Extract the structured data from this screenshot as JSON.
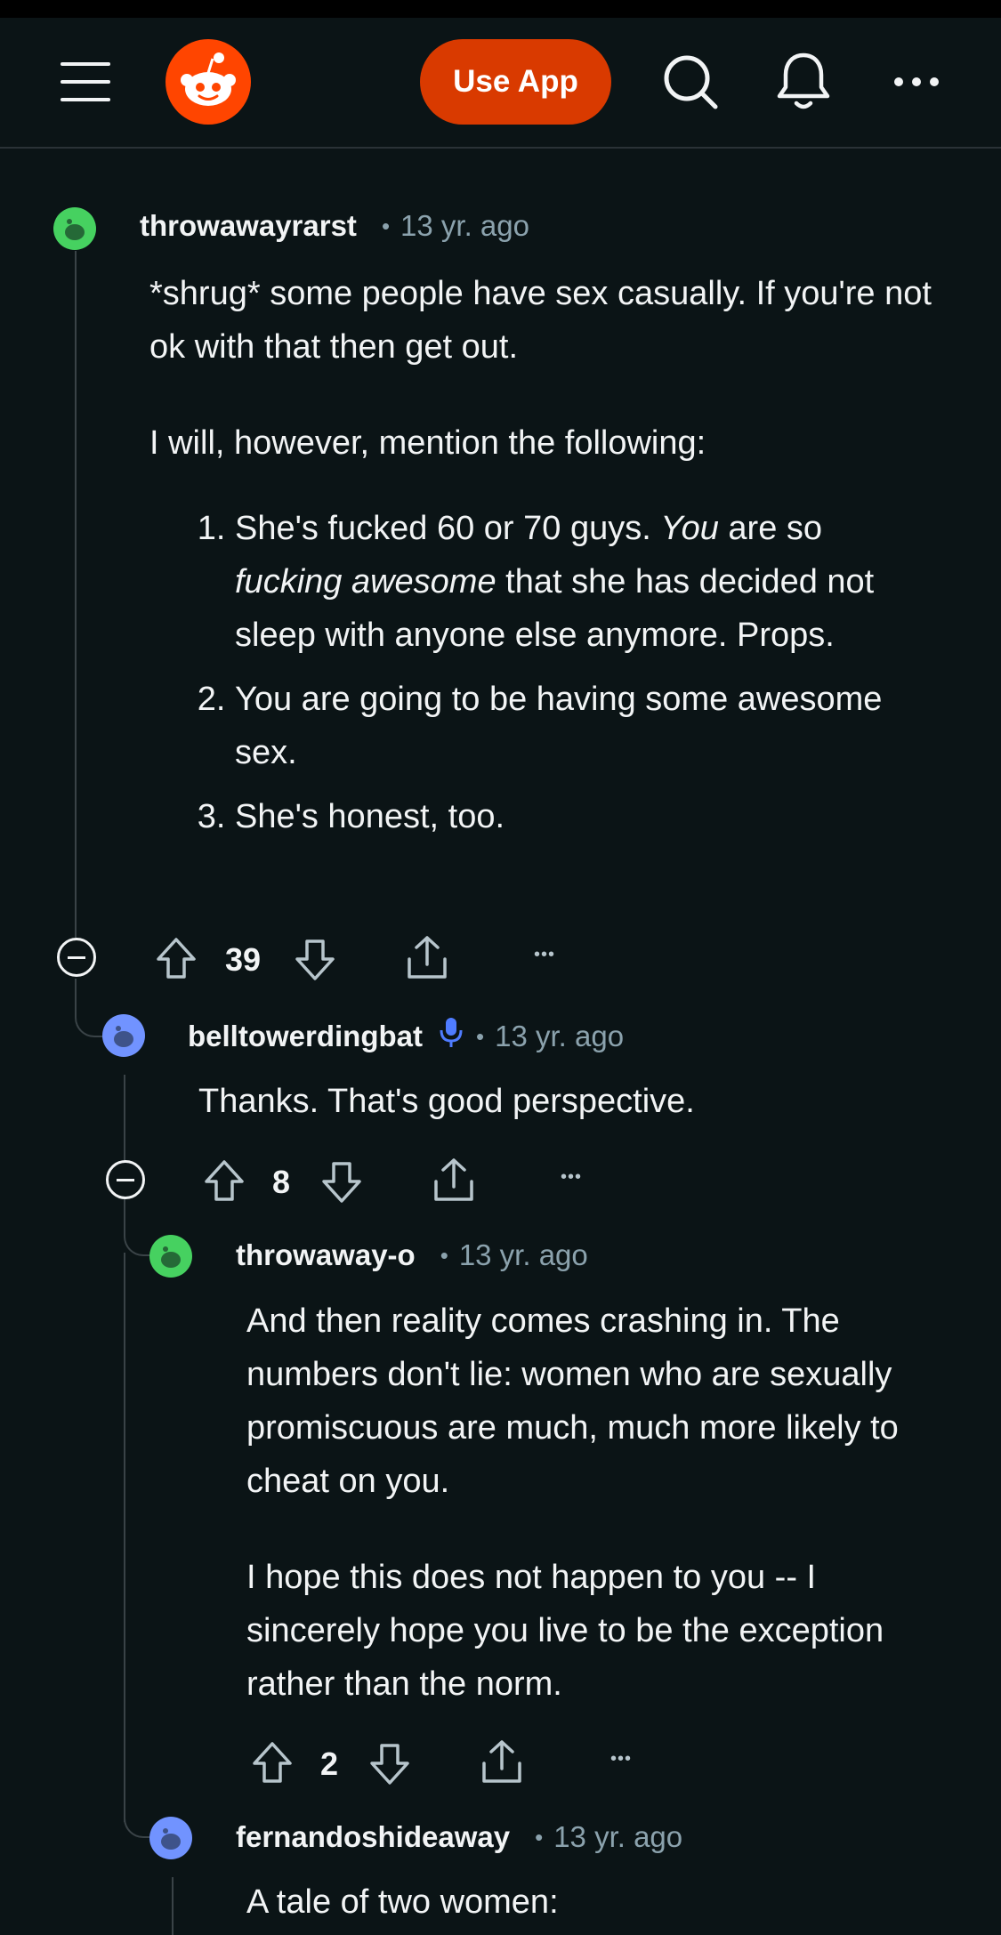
{
  "header": {
    "menu_icon": "hamburger-menu-icon",
    "logo_icon": "reddit-logo-icon",
    "use_app_label": "Use App",
    "search_icon": "search-icon",
    "notifications_icon": "bell-icon",
    "more_icon": "ellipsis-icon"
  },
  "colors": {
    "background": "#0b1416",
    "accent": "#d93a00",
    "reddit_orange": "#ff4500",
    "muted_text": "#8ba2ad",
    "thread_line": "#3a4347"
  },
  "comments": [
    {
      "author": "throwawayrarst",
      "separator": "•",
      "time": "13 yr. ago",
      "avatar_color": "#46d160",
      "paragraphs": [
        "*shrug* some people have sex casually. If you're not ok with that then get out.",
        "I will, however, mention the following:"
      ],
      "list": [
        {
          "text_a": "She's fucked 60 or 70 guys. ",
          "em_a": "You",
          "text_b": " are so ",
          "em_b": "fucking awesome",
          "text_c": " that she has decided not sleep with anyone else anymore. Props."
        },
        {
          "text": "You are going to be having some awesome sex."
        },
        {
          "text": "She's honest, too."
        }
      ],
      "votes": "39",
      "more_label": "•••"
    },
    {
      "author": "belltowerdingbat",
      "separator": "•",
      "time": "13 yr. ago",
      "badge_icon": "microphone-icon",
      "avatar_color": "#7193ff",
      "paragraphs": [
        "Thanks. That's good perspective."
      ],
      "votes": "8",
      "more_label": "•••"
    },
    {
      "author": "throwaway-o",
      "separator": "•",
      "time": "13 yr. ago",
      "avatar_color": "#46d160",
      "paragraphs": [
        "And then reality comes crashing in. The numbers don't lie: women who are sexually promiscuous are much, much more likely to cheat on you.",
        "I hope this does not happen to you -- I sincerely hope you live to be the exception rather than the norm."
      ],
      "votes": "2",
      "more_label": "•••"
    },
    {
      "author": "fernandoshideaway",
      "separator": "•",
      "time": "13 yr. ago",
      "avatar_color": "#7193ff",
      "paragraphs": [
        "A tale of two women:"
      ]
    }
  ]
}
